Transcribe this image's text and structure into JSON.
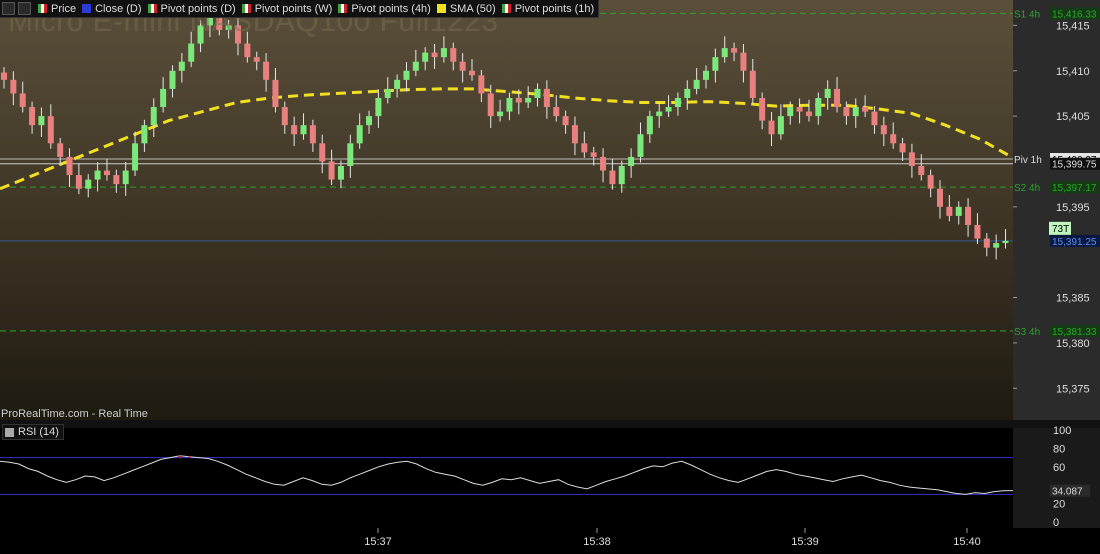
{
  "legend": {
    "items": [
      {
        "label": "Price",
        "swatch": "bar"
      },
      {
        "label": "Close (D)",
        "swatch": "#2c3ad6"
      },
      {
        "label": "Pivot points (D)",
        "swatch": "bar"
      },
      {
        "label": "Pivot points (W)",
        "swatch": "bar"
      },
      {
        "label": "Pivot points (4h)",
        "swatch": "bar"
      },
      {
        "label": "SMA (50)",
        "swatch": "#f0e020"
      },
      {
        "label": "Pivot points (1h)",
        "swatch": "bar"
      }
    ]
  },
  "watermark": "Micro E-mini NASDAQ100 Full1223",
  "source": "ProRealTime.com - Real Time",
  "rsi": {
    "title": "RSI (14)",
    "current_label": "34.087"
  },
  "colors": {
    "up": "#7ce87c",
    "down": "#e88080",
    "sma": "#f0e020",
    "pivot": "#2aa52a",
    "rsi_band": "#3333cc",
    "rsi_line": "#dddddd",
    "current_price": "#2a6cc0"
  },
  "chart_data": {
    "type": "candlestick",
    "x_ticks": [
      "15:37",
      "15:38",
      "15:39",
      "15:40"
    ],
    "y_ticks": [
      "15,415",
      "15,410",
      "15,405",
      "15,395",
      "15,385",
      "15,380",
      "15,375"
    ],
    "y_range": [
      15371.5,
      15417.8
    ],
    "levels": [
      {
        "name": "S1 4h",
        "value": 15416.33,
        "label": "15,416.33"
      },
      {
        "name": "Piv 1h",
        "value": 15400.27,
        "label": "15,400.27"
      },
      {
        "name": "",
        "value": 15399.75,
        "label": "15,399.75"
      },
      {
        "name": "S2 4h",
        "value": 15397.17,
        "label": "15,397.17"
      },
      {
        "name": "S3 4h",
        "value": 15381.33,
        "label": "15,381.33"
      }
    ],
    "current": {
      "value": 15391.25,
      "label": "15,391.25"
    },
    "tick_counter": "73T",
    "close": [
      15409,
      15407.5,
      15406,
      15404,
      15405,
      15402,
      15400.5,
      15398.5,
      15397,
      15398,
      15399,
      15398.5,
      15397.5,
      15399,
      15402,
      15404,
      15406,
      15408,
      15410,
      15411,
      15413,
      15415,
      15416,
      15414.5,
      15415,
      15413,
      15411.5,
      15411,
      15409,
      15406,
      15404,
      15403,
      15404,
      15402,
      15400,
      15398,
      15399.5,
      15402,
      15404,
      15405,
      15407,
      15408,
      15409,
      15410,
      15411,
      15412,
      15411.5,
      15412.5,
      15411,
      15410,
      15409.5,
      15407.5,
      15405,
      15405.5,
      15407,
      15406.5,
      15407,
      15408,
      15406,
      15405,
      15404,
      15402,
      15401,
      15400.5,
      15399,
      15397.5,
      15399.5,
      15400.5,
      15403,
      15405,
      15405.5,
      15406,
      15407,
      15408,
      15409,
      15410,
      15411.5,
      15412.5,
      15412,
      15410,
      15407,
      15404.5,
      15403,
      15405,
      15406,
      15405.5,
      15405,
      15407,
      15408,
      15406,
      15405,
      15406,
      15405.5,
      15404,
      15403,
      15402,
      15401,
      15399.5,
      15398.5,
      15397,
      15395,
      15394,
      15395,
      15393,
      15391.5,
      15390.5,
      15391,
      15391.25
    ],
    "sma50": [
      15397,
      15398.5,
      15400,
      15401.5,
      15403,
      15404.5,
      15405.5,
      15406.5,
      15407,
      15407.3,
      15407.5,
      15407.7,
      15407.9,
      15408,
      15408,
      15407.7,
      15407.4,
      15407,
      15406.7,
      15406.5,
      15406.5,
      15406.6,
      15406.4,
      15406.1,
      15406.2,
      15406.2,
      15405.8,
      15405.3,
      15404,
      15402.5,
      15400.4
    ],
    "rsi": {
      "y_ticks": [
        "100",
        "80",
        "60",
        "20",
        "0"
      ],
      "range": [
        0,
        100
      ],
      "bands": [
        70,
        30
      ],
      "current": 34.087,
      "values": [
        66,
        65,
        63,
        58,
        55,
        50,
        46,
        43,
        46,
        50,
        49,
        45,
        48,
        52,
        56,
        60,
        64,
        68,
        70,
        72,
        71,
        70,
        69,
        66,
        62,
        57,
        52,
        48,
        44,
        41,
        40,
        44,
        48,
        45,
        41,
        40,
        43,
        48,
        52,
        56,
        60,
        63,
        65,
        66,
        63,
        58,
        54,
        52,
        50,
        46,
        42,
        40,
        43,
        47,
        46,
        48,
        45,
        42,
        44,
        46,
        41,
        38,
        36,
        40,
        44,
        47,
        50,
        54,
        58,
        61,
        60,
        64,
        66,
        62,
        57,
        52,
        48,
        45,
        43,
        47,
        51,
        55,
        57,
        55,
        52,
        50,
        48,
        46,
        44,
        47,
        49,
        51,
        48,
        45,
        43,
        40,
        38,
        37,
        36,
        35,
        33,
        31,
        30,
        32,
        31,
        33,
        34,
        34.087
      ]
    }
  }
}
